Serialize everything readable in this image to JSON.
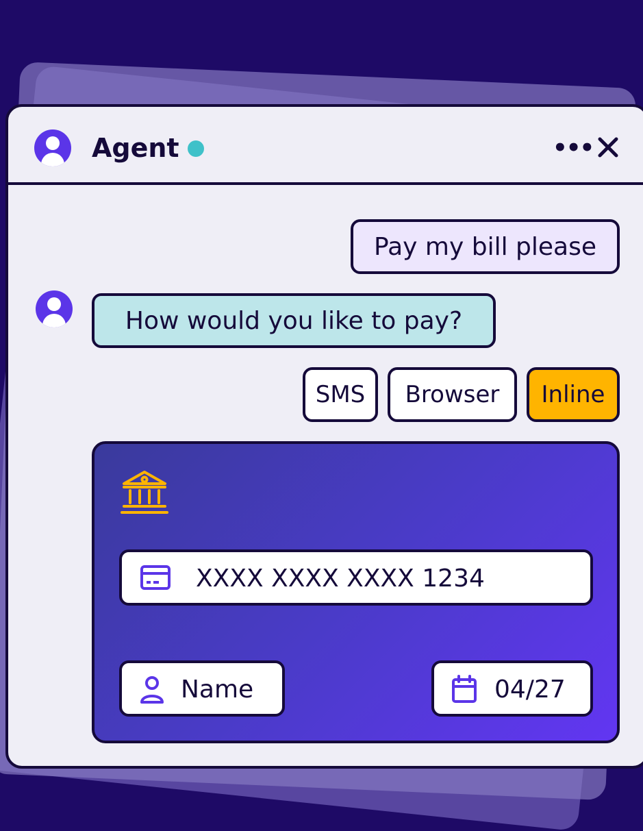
{
  "header": {
    "agent_name": "Agent",
    "status": "online",
    "more_icon": "more-dots-icon",
    "close_icon": "close-icon"
  },
  "chat": {
    "user_message": "Pay my bill please",
    "agent_message": "How would you like to pay?",
    "options": [
      {
        "label": "SMS",
        "selected": false
      },
      {
        "label": "Browser",
        "selected": false
      },
      {
        "label": "Inline",
        "selected": true
      }
    ]
  },
  "payment_card": {
    "bank_icon": "bank-icon",
    "card_number": "XXXX XXXX XXXX 1234",
    "name_placeholder": "Name",
    "expiry": "04/27"
  },
  "colors": {
    "background": "#1e0a66",
    "accent": "#5b35e8",
    "status": "#3fc1c9",
    "selected_option": "#ffb400",
    "agent_bubble": "#bde6ea",
    "user_bubble": "#ede6fd"
  }
}
